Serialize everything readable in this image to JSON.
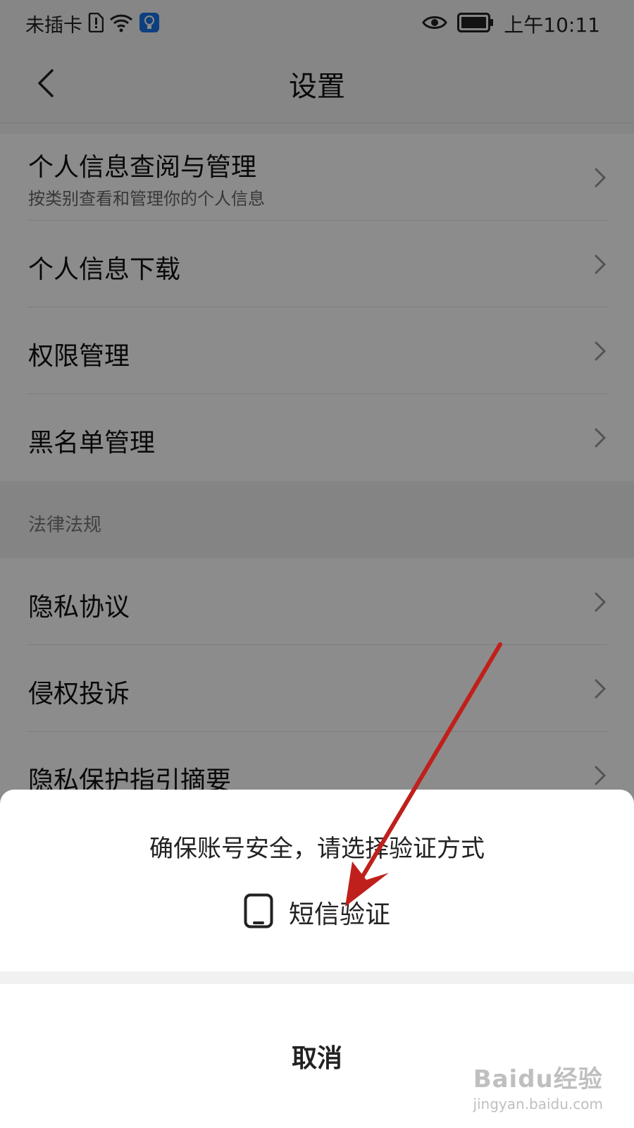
{
  "status_bar": {
    "carrier": "未插卡",
    "time": "上午10:11"
  },
  "nav": {
    "title": "设置"
  },
  "section_personal": {
    "items": [
      {
        "label": "个人信息查阅与管理",
        "sub": "按类别查看和管理你的个人信息"
      },
      {
        "label": "个人信息下载"
      },
      {
        "label": "权限管理"
      },
      {
        "label": "黑名单管理"
      }
    ]
  },
  "section_legal": {
    "header": "法律法规",
    "items": [
      {
        "label": "隐私协议"
      },
      {
        "label": "侵权投诉"
      },
      {
        "label": "隐私保护指引摘要"
      }
    ]
  },
  "sheet": {
    "message": "确保账号安全，请选择验证方式",
    "option_sms": "短信验证",
    "cancel": "取消"
  },
  "colors": {
    "annotation_arrow": "#c0201b"
  },
  "watermark": {
    "logo": "Baidu经验",
    "url": "jingyan.baidu.com"
  }
}
